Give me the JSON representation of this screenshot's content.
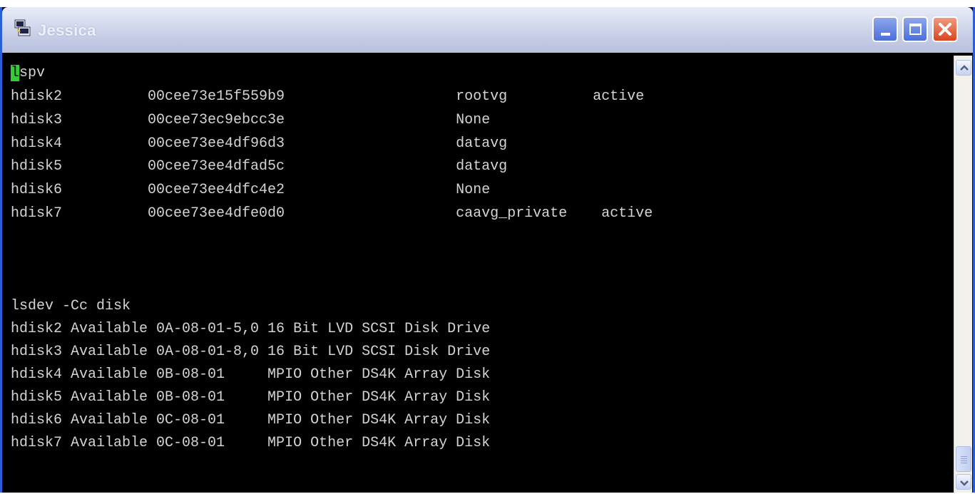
{
  "window": {
    "title": "Jessica",
    "icon": "putty-icon",
    "controls": {
      "minimize": "minimize-icon",
      "maximize": "maximize-icon",
      "close": "close-icon"
    }
  },
  "terminal": {
    "cursor_char": "l",
    "first_line_rest": "spv",
    "lines": [
      "hdisk2          00cee73e15f559b9                    rootvg          active",
      "hdisk3          00cee73ec9ebcc3e                    None",
      "hdisk4          00cee73ee4df96d3                    datavg",
      "hdisk5          00cee73ee4dfad5c                    datavg",
      "hdisk6          00cee73ee4dfc4e2                    None",
      "hdisk7          00cee73ee4dfe0d0                    caavg_private    active",
      "",
      "",
      "",
      "lsdev -Cc disk",
      "hdisk2 Available 0A-08-01-5,0 16 Bit LVD SCSI Disk Drive",
      "hdisk3 Available 0A-08-01-8,0 16 Bit LVD SCSI Disk Drive",
      "hdisk4 Available 0B-08-01     MPIO Other DS4K Array Disk",
      "hdisk5 Available 0B-08-01     MPIO Other DS4K Array Disk",
      "hdisk6 Available 0C-08-01     MPIO Other DS4K Array Disk",
      "hdisk7 Available 0C-08-01     MPIO Other DS4K Array Disk"
    ]
  },
  "colors": {
    "terminal_bg": "#000000",
    "terminal_fg": "#d4d4d4",
    "cursor": "#33cc33",
    "titlebar": "#c4cbe4"
  }
}
